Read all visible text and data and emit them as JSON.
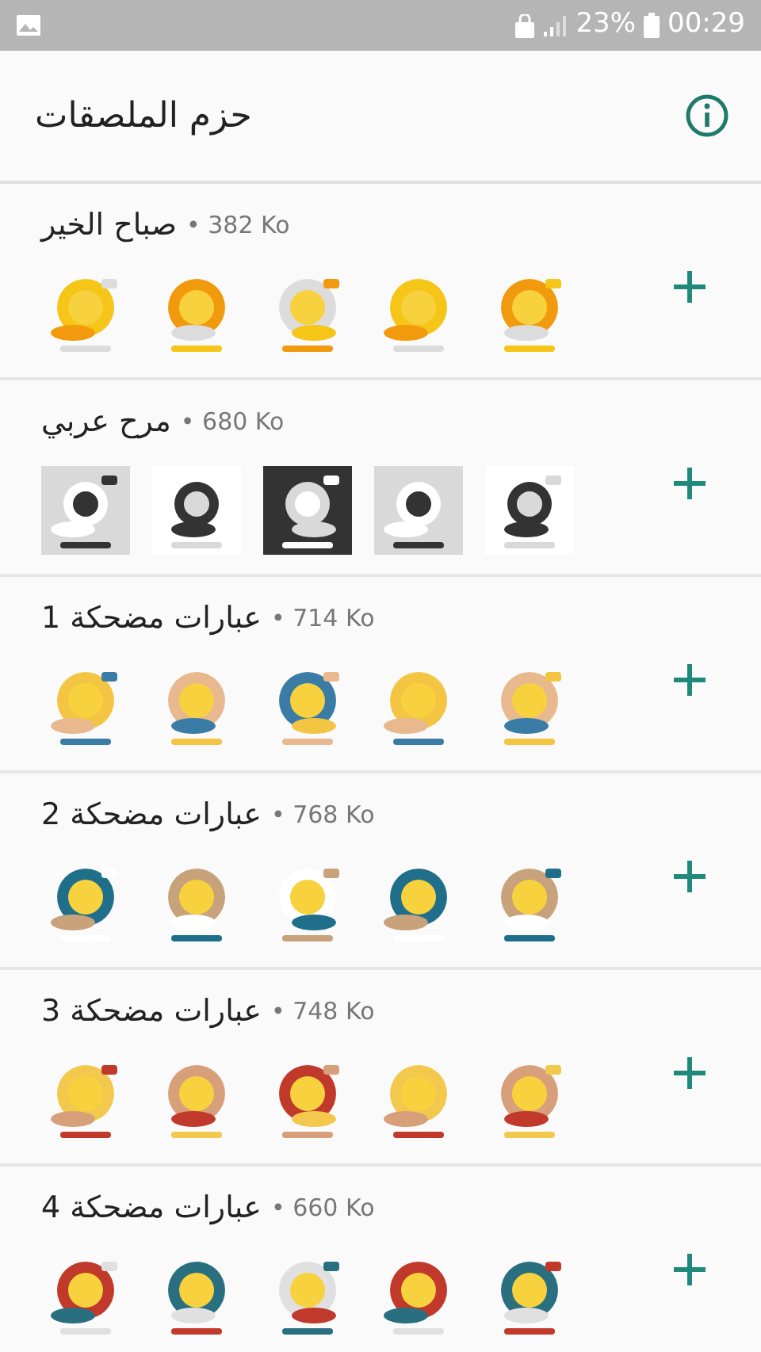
{
  "status_bar": {
    "battery": "23%",
    "time": "00:29"
  },
  "header": {
    "title": "حزم الملصقات"
  },
  "packs": [
    {
      "name": "صباح الخير",
      "size": "• 382 Ko"
    },
    {
      "name": "مرح عربي",
      "size": "• 680 Ko"
    },
    {
      "name": "عبارات مضحكة 1",
      "size": "• 714 Ko"
    },
    {
      "name": "عبارات مضحكة 2",
      "size": "• 768 Ko"
    },
    {
      "name": "عبارات مضحكة 3",
      "size": "• 748 Ko"
    },
    {
      "name": "عبارات مضحكة 4",
      "size": "• 660 Ko"
    }
  ]
}
